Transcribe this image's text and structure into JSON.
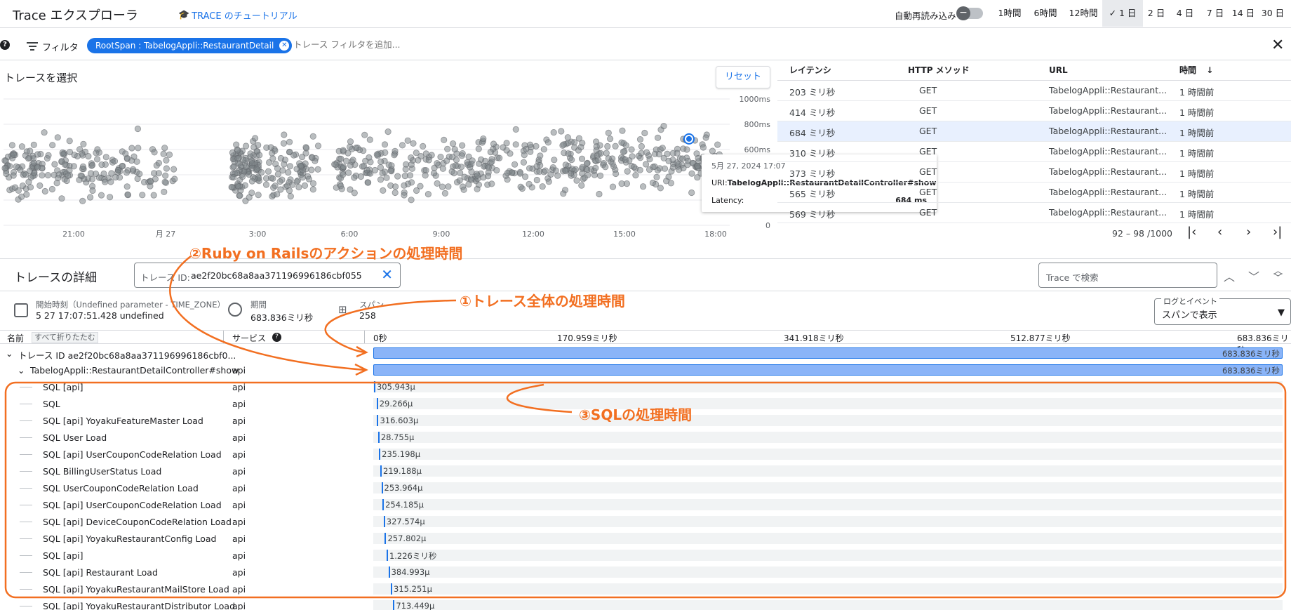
{
  "header": {
    "title": "Trace エクスプローラ",
    "tutorial": "TRACE のチュートリアル",
    "autoreload": "自動再読み込み",
    "time_ranges": [
      "1時間",
      "6時間",
      "12時間",
      "1 日",
      "2 日",
      "4 日",
      "7 日",
      "14 日",
      "30 日"
    ],
    "selected_range": "1 日"
  },
  "filter": {
    "label": "フィルタ",
    "chip": "RootSpan : TabelogAppli::RestaurantDetail",
    "placeholder": "トレース フィルタを追加..."
  },
  "chart": {
    "title": "トレースを選択",
    "reset": "リセット",
    "y_ticks": [
      "1000ms",
      "800ms",
      "600ms",
      "400ms",
      "200ms",
      "0"
    ],
    "x_ticks": [
      "21:00",
      "月 27",
      "3:00",
      "6:00",
      "9:00",
      "12:00",
      "15:00",
      "18:00"
    ]
  },
  "chart_data": {
    "type": "scatter",
    "xlabel": "",
    "ylabel": "",
    "y_ticks": [
      "1000ms",
      "800ms",
      "600ms",
      "400ms",
      "200ms",
      "0"
    ],
    "x_ticks": [
      "21:00",
      "月 27",
      "3:00",
      "6:00",
      "9:00",
      "12:00",
      "15:00",
      "18:00"
    ],
    "ylim": [
      0,
      1000
    ],
    "selected_point": {
      "y": 684
    }
  },
  "tooltip": {
    "date": "5月 27, 2024 17:07",
    "uri_label": "URI:",
    "uri": "TabelogAppli::RestaurantDetailController#show",
    "latency_label": "Latency:",
    "latency": "684 ms"
  },
  "table": {
    "columns": [
      "レイテンシ",
      "HTTP メソッド",
      "URL",
      "時間"
    ],
    "rows": [
      {
        "latency": "203 ミリ秒",
        "method": "GET",
        "url": "TabelogAppli::Restaurant...",
        "time": "1 時間前"
      },
      {
        "latency": "414 ミリ秒",
        "method": "GET",
        "url": "TabelogAppli::Restaurant...",
        "time": "1 時間前"
      },
      {
        "latency": "684 ミリ秒",
        "method": "GET",
        "url": "TabelogAppli::Restaurant...",
        "time": "1 時間前"
      },
      {
        "latency": "310 ミリ秒",
        "method": "GET",
        "url": "TabelogAppli::Restaurant...",
        "time": "1 時間前"
      },
      {
        "latency": "373 ミリ秒",
        "method": "GET",
        "url": "TabelogAppli::Restaurant...",
        "time": "1 時間前"
      },
      {
        "latency": "565 ミリ秒",
        "method": "GET",
        "url": "TabelogAppli::Restaurant...",
        "time": "1 時間前"
      },
      {
        "latency": "569 ミリ秒",
        "method": "GET",
        "url": "TabelogAppli::Restaurant...",
        "time": "1 時間前"
      }
    ],
    "pagination": "92 – 98 /1000"
  },
  "details": {
    "title": "トレースの詳細",
    "trace_id_label": "トレース ID:",
    "trace_id": "ae2f20bc68a8aa371196996186cbf055",
    "search_placeholder": "Trace で検索",
    "start_label": "開始時刻（Undefined parameter - TIME_ZONE）",
    "start_value": "5 27 17:07:51.428 undefined",
    "duration_label": "期間",
    "duration_value": "683.836ミリ秒",
    "spans_label": "スパン",
    "spans_value": "258",
    "log_label": "ログとイベント",
    "log_value": "スパンで表示"
  },
  "span_tree": {
    "name_header": "名前",
    "collapse_all": "すべて折りたたむ",
    "service_header": "サービス",
    "axis_ticks": [
      "0秒",
      "170.959ミリ秒",
      "341.918ミリ秒",
      "512.877ミリ秒",
      "683.836ミリ秒"
    ],
    "total_ms": 683.836,
    "rows": [
      {
        "name": "トレース ID ae2f20bc68a8aa371196996186cbf0...",
        "service": "",
        "start_ms": 0,
        "dur_ms": 683.836,
        "dur_label": "683.836ミリ秒",
        "level": 0
      },
      {
        "name": "TabelogAppli::RestaurantDetailController#show",
        "service": "api",
        "start_ms": 0,
        "dur_ms": 683.836,
        "dur_label": "683.836ミリ秒",
        "level": 1
      },
      {
        "name": "SQL [api]",
        "service": "api",
        "start_ms": 0.5,
        "dur_ms": 0.306,
        "dur_label": "305.943μ",
        "level": 2
      },
      {
        "name": "SQL",
        "service": "api",
        "start_ms": 2.5,
        "dur_ms": 0.029,
        "dur_label": "29.266μ",
        "level": 2
      },
      {
        "name": "SQL [api] YoyakuFeatureMaster Load",
        "service": "api",
        "start_ms": 2.9,
        "dur_ms": 0.317,
        "dur_label": "316.603μ",
        "level": 2
      },
      {
        "name": "SQL User Load",
        "service": "api",
        "start_ms": 3.6,
        "dur_ms": 0.029,
        "dur_label": "28.755μ",
        "level": 2
      },
      {
        "name": "SQL [api] UserCouponCodeRelation Load",
        "service": "api",
        "start_ms": 4.3,
        "dur_ms": 0.235,
        "dur_label": "235.198μ",
        "level": 2
      },
      {
        "name": "SQL BillingUserStatus Load",
        "service": "api",
        "start_ms": 5.3,
        "dur_ms": 0.219,
        "dur_label": "219.188μ",
        "level": 2
      },
      {
        "name": "SQL UserCouponCodeRelation Load",
        "service": "api",
        "start_ms": 6.1,
        "dur_ms": 0.254,
        "dur_label": "253.964μ",
        "level": 2
      },
      {
        "name": "SQL [api] UserCouponCodeRelation Load",
        "service": "api",
        "start_ms": 6.9,
        "dur_ms": 0.254,
        "dur_label": "254.185μ",
        "level": 2
      },
      {
        "name": "SQL [api] DeviceCouponCodeRelation Load",
        "service": "api",
        "start_ms": 7.8,
        "dur_ms": 0.328,
        "dur_label": "327.574μ",
        "level": 2
      },
      {
        "name": "SQL [api] YoyakuRestaurantConfig Load",
        "service": "api",
        "start_ms": 8.7,
        "dur_ms": 0.258,
        "dur_label": "257.802μ",
        "level": 2
      },
      {
        "name": "SQL [api]",
        "service": "api",
        "start_ms": 10.0,
        "dur_ms": 1.226,
        "dur_label": "1.226ミリ秒",
        "level": 2
      },
      {
        "name": "SQL [api] Restaurant Load",
        "service": "api",
        "start_ms": 11.4,
        "dur_ms": 0.385,
        "dur_label": "384.993μ",
        "level": 2
      },
      {
        "name": "SQL [api] YoyakuRestaurantMailStore Load",
        "service": "api",
        "start_ms": 13.2,
        "dur_ms": 0.315,
        "dur_label": "315.251μ",
        "level": 2
      },
      {
        "name": "SQL [api] YoyakuRestaurantDistributor Load",
        "service": "api",
        "start_ms": 15.0,
        "dur_ms": 0.713,
        "dur_label": "713.449μ",
        "level": 2
      }
    ]
  },
  "annotations": {
    "a1": "①トレース全体の処理時間",
    "a2": "②Ruby on Railsのアクションの処理時間",
    "a3": "③SQLの処理時間"
  },
  "colors": {
    "accent": "#1a73e8",
    "annotation": "#f26f21",
    "bar": "#8ab4f8"
  }
}
